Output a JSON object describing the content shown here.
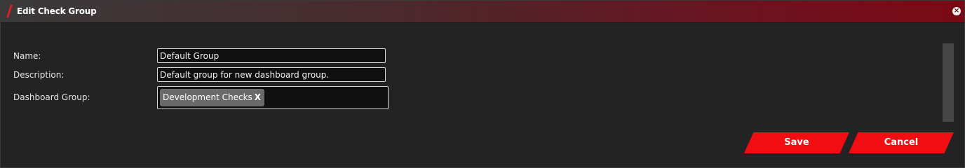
{
  "dialog": {
    "title": "Edit Check Group",
    "close_icon_glyph": "×"
  },
  "form": {
    "name_label": "Name:",
    "name_value": "Default Group",
    "description_label": "Description:",
    "description_value": "Default group for new dashboard group.",
    "dashboard_group_label": "Dashboard Group:",
    "dashboard_group_tags": [
      {
        "label": "Development Checks",
        "remove": "X"
      }
    ]
  },
  "buttons": {
    "save_label": "Save",
    "cancel_label": "Cancel"
  },
  "colors": {
    "accent_red": "#f20d13",
    "title_gradient_end": "#7a0a14",
    "background": "#232323"
  }
}
